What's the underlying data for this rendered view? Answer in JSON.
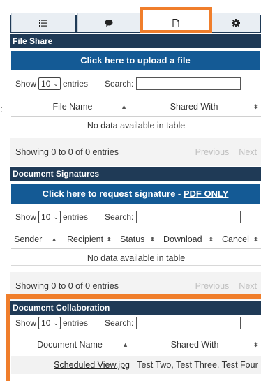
{
  "stray_colon": ":",
  "tabs": [
    {
      "icon": "list-icon"
    },
    {
      "icon": "comment-icon"
    },
    {
      "icon": "file-icon"
    },
    {
      "icon": "gear-icon"
    }
  ],
  "highlight_color": "#f07e2b",
  "file_share": {
    "title": "File Share",
    "upload_label": "Click here to upload a file",
    "show_label": "Show",
    "entries_value": "10",
    "entries_label": "entries",
    "search_label": "Search:",
    "columns": [
      "File Name",
      "Shared With"
    ],
    "empty_text": "No data available in table",
    "info": "Showing 0 to 0 of 0 entries",
    "previous": "Previous",
    "next": "Next"
  },
  "document_signatures": {
    "title": "Document Signatures",
    "request_label": "Click here to request signature - ",
    "request_link": "PDF ONLY",
    "show_label": "Show",
    "entries_value": "10",
    "entries_label": "entries",
    "search_label": "Search:",
    "columns": [
      "Sender",
      "Recipient",
      "Status",
      "Download",
      "Cancel"
    ],
    "empty_text": "No data available in table",
    "info": "Showing 0 to 0 of 0 entries",
    "previous": "Previous",
    "next": "Next"
  },
  "document_collaboration": {
    "title": "Document Collaboration",
    "show_label": "Show",
    "entries_value": "10",
    "entries_label": "entries",
    "search_label": "Search:",
    "columns": [
      "Document Name",
      "Shared With"
    ],
    "rows": [
      {
        "document_name": "Scheduled View.jpg",
        "shared_with": "Test Two, Test Three, Test Four"
      }
    ]
  }
}
